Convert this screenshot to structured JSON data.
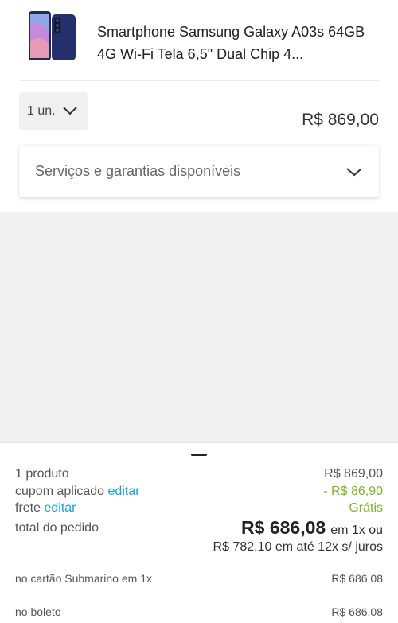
{
  "product": {
    "title": "Smartphone Samsung Galaxy A03s 64GB 4G Wi-Fi Tela 6,5\" Dual Chip 4...",
    "quantity": "1 un.",
    "price": "R$ 869,00",
    "image_icon": "smartphone-thumbnail"
  },
  "services": {
    "label": "Serviços e garantias disponíveis"
  },
  "summary": {
    "products_label": "1 produto",
    "products_value": "R$ 869,00",
    "coupon_label": "cupom aplicado",
    "coupon_link": "editar",
    "coupon_value": "- R$ 86,90",
    "shipping_label": "frete",
    "shipping_link": "editar",
    "shipping_value": "Grátis",
    "total_label": "total do pedido",
    "total_value": "R$ 686,08",
    "total_suffix": "em 1x ou",
    "installments": "R$ 782,10 em até 12x s/ juros",
    "card_label": "no cartão Submarino em 1x",
    "card_value": "R$ 686,08",
    "boleto_label": "no boleto",
    "boleto_value": "R$ 686,08"
  },
  "colors": {
    "link": "#1aa1d8",
    "discount": "#80b32a",
    "background_gray": "#f0f0f0"
  }
}
